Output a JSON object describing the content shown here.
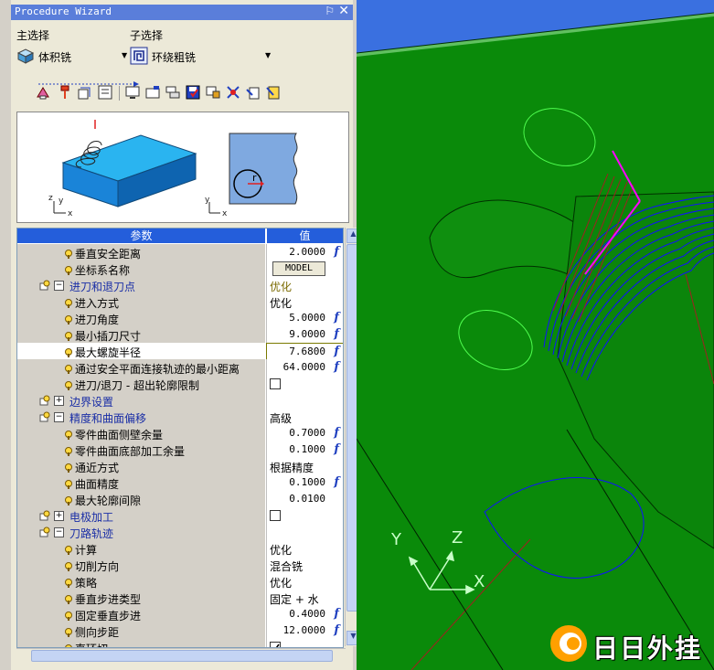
{
  "panel": {
    "title": "Procedure Wizard",
    "pin_glyph": "⚐",
    "close_glyph": "✕",
    "main_label": "主选择",
    "sub_label": "子选择",
    "main_value": "体积铣",
    "sub_value": "环绕粗铣"
  },
  "grid": {
    "col_param": "参数",
    "col_value": "值",
    "rows": [
      {
        "type": "item",
        "label": "垂直安全距离",
        "value": "2.0000",
        "fx": "f"
      },
      {
        "type": "item",
        "label": "坐标系名称",
        "button": "MODEL"
      },
      {
        "type": "group",
        "label": "进刀和退刀点",
        "value": "优化",
        "open": "−"
      },
      {
        "type": "item",
        "label": "进入方式",
        "value": "优化"
      },
      {
        "type": "item",
        "label": "进刀角度",
        "value": "5.0000",
        "fx": "f"
      },
      {
        "type": "item",
        "label": "最小插刀尺寸",
        "value": "9.0000",
        "fx": "f"
      },
      {
        "type": "item",
        "label": "最大螺旋半径",
        "value": "7.6800",
        "fx": "f",
        "selected": true
      },
      {
        "type": "item",
        "label": "通过安全平面连接轨迹的最小距离",
        "value": "64.0000",
        "fx": "f"
      },
      {
        "type": "item",
        "label": "进刀/退刀 - 超出轮廓限制",
        "check": true
      },
      {
        "type": "group",
        "label": "边界设置",
        "open": "+"
      },
      {
        "type": "group",
        "label": "精度和曲面偏移",
        "value": "高级",
        "open": "−"
      },
      {
        "type": "item",
        "label": "零件曲面侧壁余量",
        "value": "0.7000",
        "fx": "f"
      },
      {
        "type": "item",
        "label": "零件曲面底部加工余量",
        "value": "0.1000",
        "fx": "f"
      },
      {
        "type": "item",
        "label": "通近方式",
        "value": "根据精度"
      },
      {
        "type": "item",
        "label": "曲面精度",
        "value": "0.1000",
        "fx": "f"
      },
      {
        "type": "item",
        "label": "最大轮廓间隙",
        "value": "0.0100"
      },
      {
        "type": "group",
        "label": "电极加工",
        "check": true,
        "open": "+"
      },
      {
        "type": "group",
        "label": "刀路轨迹",
        "open": "−"
      },
      {
        "type": "item",
        "label": "计算",
        "value": "优化"
      },
      {
        "type": "item",
        "label": "切削方向",
        "value": "混合铣"
      },
      {
        "type": "item",
        "label": "策略",
        "value": "优化"
      },
      {
        "type": "item",
        "label": "垂直步进类型",
        "value": "固定 + 水"
      },
      {
        "type": "item",
        "label": "固定垂直步进",
        "value": "0.4000",
        "fx": "f"
      },
      {
        "type": "item",
        "label": "侧向步距",
        "value": "12.0000",
        "fx": "f"
      },
      {
        "type": "item",
        "label": "直环切",
        "check": true,
        "checked": true
      }
    ]
  },
  "preview": {
    "r_label": "r",
    "ax_x": "x",
    "ax_y": "y",
    "ax_z": "z"
  },
  "viewport": {
    "axis_x": "X",
    "axis_y": "Y",
    "axis_z": "Z",
    "watermark": "日日外挂",
    "colors": {
      "background": "#0a8a0a",
      "toolpath": "#1010ff",
      "accent": "#ff00ff",
      "axis": "#c8ffc8"
    }
  },
  "icons": [
    "volume-mill-icon",
    "spiral-rough-icon",
    "tool-icon",
    "toolpath-icon",
    "param-icon",
    "save-icon",
    "settings-icon",
    "rotate-icon",
    "export-icon",
    "scissors-icon",
    "check-icon"
  ]
}
